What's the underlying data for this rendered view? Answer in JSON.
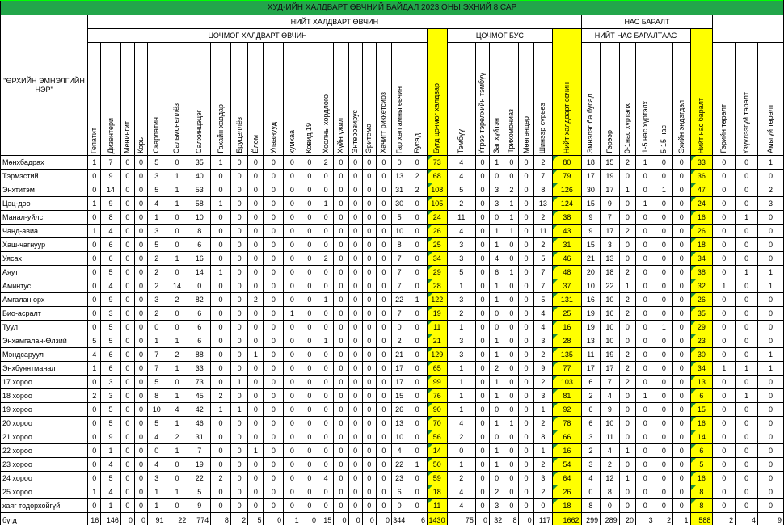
{
  "title": "ХУД-ИЙН ХАЛДВАРТ ӨВЧНИЙ БАЙДАЛ 2023 ОНЫ ЭХНИЙ 8 САР",
  "headers": {
    "total_infectious": "НИЙТ ХАЛДВАРТ ӨВЧИН",
    "population_loss": "НАС БАРАЛТ",
    "acute_infectious": "ЦОЧМОГ ХАЛДВАРТ ӨВЧИН",
    "non_acute": "ЦОЧМОГ БУС",
    "of_total_deaths": "НИЙТ НАС БАРАЛТААС",
    "facility_name": "\"ӨРХИЙН ЭМНЭЛГИЙН НЭР\""
  },
  "columns": [
    "Гепатит",
    "Дизентери",
    "Менингит",
    "Корь",
    "Скарлатин",
    "Сальмонеллёз",
    "Салхинцэцэг",
    "Гахайн хавдар",
    "Бруцеллёз",
    "Ёлом",
    "Улаанууд",
    "хумхаа",
    "Ковид 19",
    "Хоолны хордлого",
    "Хүйн үжил",
    "Энтеровирус",
    "Эритема",
    "Хачигт риккетсиоз",
    "Гар хөл амны өвчин",
    "Бусад",
    "Бүгд цочмог халдвар",
    "Тэмбүү",
    "Үтрээ тэрелхийн тэмбүү",
    "Заг хүйтэн",
    "Трихомониаз",
    "Мөөгөнцөр",
    "Шинээр сүрьеэ",
    "Нийт халдварт өвчин",
    "Эмнэлэг ба бусад",
    "Гэрээр",
    "0-1нас хүртэлх",
    "1-5 нас хүртэлх",
    "5-15 нас",
    "Эхийн эндэгдэл",
    "Нийт нас баралт",
    "Гэрийн төрөлт",
    "Үзүүлээгүй төрөлт",
    "Амьгүй төрөлт"
  ],
  "rows": [
    {
      "name": "Мөнхбадрах",
      "values": [
        "1",
        "7",
        "0",
        "0",
        "5",
        "0",
        "35",
        "1",
        "0",
        "0",
        "0",
        "0",
        "0",
        "2",
        "0",
        "0",
        "0",
        "0",
        "0",
        "0",
        "73",
        "4",
        "0",
        "1",
        "0",
        "0",
        "2",
        "80",
        "18",
        "15",
        "2",
        "1",
        "0",
        "0",
        "33",
        "0",
        "0",
        "1"
      ]
    },
    {
      "name": "Тэрмэстий",
      "values": [
        "0",
        "9",
        "0",
        "0",
        "3",
        "1",
        "40",
        "0",
        "0",
        "0",
        "0",
        "0",
        "0",
        "0",
        "0",
        "0",
        "0",
        "0",
        "13",
        "2",
        "68",
        "4",
        "0",
        "0",
        "0",
        "0",
        "7",
        "79",
        "17",
        "19",
        "0",
        "0",
        "0",
        "0",
        "36",
        "0",
        "0",
        "0"
      ]
    },
    {
      "name": "Энхтитэм",
      "values": [
        "0",
        "14",
        "0",
        "0",
        "5",
        "1",
        "53",
        "0",
        "0",
        "0",
        "0",
        "0",
        "0",
        "0",
        "0",
        "0",
        "0",
        "0",
        "31",
        "2",
        "108",
        "5",
        "0",
        "3",
        "2",
        "0",
        "8",
        "126",
        "30",
        "17",
        "1",
        "0",
        "1",
        "0",
        "47",
        "0",
        "0",
        "2"
      ]
    },
    {
      "name": "Цэц-доо",
      "values": [
        "1",
        "9",
        "0",
        "0",
        "4",
        "1",
        "58",
        "1",
        "0",
        "0",
        "0",
        "0",
        "0",
        "1",
        "0",
        "0",
        "0",
        "0",
        "30",
        "0",
        "105",
        "2",
        "0",
        "3",
        "1",
        "0",
        "13",
        "124",
        "15",
        "9",
        "0",
        "1",
        "0",
        "0",
        "24",
        "0",
        "0",
        "3"
      ]
    },
    {
      "name": "Манал-уйлс",
      "values": [
        "0",
        "8",
        "0",
        "0",
        "1",
        "0",
        "10",
        "0",
        "0",
        "0",
        "0",
        "0",
        "0",
        "0",
        "0",
        "0",
        "0",
        "0",
        "5",
        "0",
        "24",
        "11",
        "0",
        "0",
        "1",
        "0",
        "2",
        "38",
        "9",
        "7",
        "0",
        "0",
        "0",
        "0",
        "16",
        "0",
        "1",
        "0"
      ]
    },
    {
      "name": "Чанд-авиа",
      "values": [
        "1",
        "4",
        "0",
        "0",
        "3",
        "0",
        "8",
        "0",
        "0",
        "0",
        "0",
        "0",
        "0",
        "0",
        "0",
        "0",
        "0",
        "0",
        "10",
        "0",
        "26",
        "4",
        "0",
        "1",
        "1",
        "0",
        "11",
        "43",
        "9",
        "17",
        "2",
        "0",
        "0",
        "0",
        "26",
        "0",
        "0",
        "0"
      ]
    },
    {
      "name": "Хаш-чагнуур",
      "values": [
        "0",
        "6",
        "0",
        "0",
        "5",
        "0",
        "6",
        "0",
        "0",
        "0",
        "0",
        "0",
        "0",
        "0",
        "0",
        "0",
        "0",
        "0",
        "8",
        "0",
        "25",
        "3",
        "0",
        "1",
        "0",
        "0",
        "2",
        "31",
        "15",
        "3",
        "0",
        "0",
        "0",
        "0",
        "18",
        "0",
        "0",
        "0"
      ]
    },
    {
      "name": "Уясах",
      "values": [
        "0",
        "6",
        "0",
        "0",
        "2",
        "1",
        "16",
        "0",
        "0",
        "0",
        "0",
        "0",
        "0",
        "2",
        "0",
        "0",
        "0",
        "0",
        "7",
        "0",
        "34",
        "3",
        "0",
        "4",
        "0",
        "0",
        "5",
        "46",
        "21",
        "13",
        "0",
        "0",
        "0",
        "0",
        "34",
        "0",
        "0",
        "0"
      ]
    },
    {
      "name": "Аяут",
      "values": [
        "0",
        "5",
        "0",
        "0",
        "2",
        "0",
        "14",
        "1",
        "0",
        "0",
        "0",
        "0",
        "0",
        "0",
        "0",
        "0",
        "0",
        "0",
        "7",
        "0",
        "29",
        "5",
        "0",
        "6",
        "1",
        "0",
        "7",
        "48",
        "20",
        "18",
        "2",
        "0",
        "0",
        "0",
        "38",
        "0",
        "1",
        "1"
      ]
    },
    {
      "name": "Аминтус",
      "values": [
        "0",
        "4",
        "0",
        "0",
        "2",
        "14",
        "0",
        "0",
        "0",
        "0",
        "0",
        "0",
        "0",
        "0",
        "0",
        "0",
        "0",
        "0",
        "7",
        "0",
        "28",
        "1",
        "0",
        "1",
        "0",
        "0",
        "7",
        "37",
        "10",
        "22",
        "1",
        "0",
        "0",
        "0",
        "32",
        "1",
        "0",
        "1"
      ]
    },
    {
      "name": "Амгалан өрх",
      "values": [
        "0",
        "9",
        "0",
        "0",
        "3",
        "2",
        "82",
        "0",
        "0",
        "2",
        "0",
        "0",
        "0",
        "1",
        "0",
        "0",
        "0",
        "0",
        "22",
        "1",
        "122",
        "3",
        "0",
        "1",
        "0",
        "0",
        "5",
        "131",
        "16",
        "10",
        "2",
        "0",
        "0",
        "0",
        "26",
        "0",
        "0",
        "0"
      ]
    },
    {
      "name": "Био-асралт",
      "values": [
        "0",
        "3",
        "0",
        "0",
        "2",
        "0",
        "6",
        "0",
        "0",
        "0",
        "0",
        "1",
        "0",
        "0",
        "0",
        "0",
        "0",
        "0",
        "7",
        "0",
        "19",
        "2",
        "0",
        "0",
        "0",
        "0",
        "4",
        "25",
        "19",
        "16",
        "2",
        "0",
        "0",
        "0",
        "35",
        "0",
        "0",
        "0"
      ]
    },
    {
      "name": "Туул",
      "values": [
        "0",
        "5",
        "0",
        "0",
        "0",
        "0",
        "6",
        "0",
        "0",
        "0",
        "0",
        "0",
        "0",
        "0",
        "0",
        "0",
        "0",
        "0",
        "0",
        "0",
        "11",
        "1",
        "0",
        "0",
        "0",
        "0",
        "4",
        "16",
        "19",
        "10",
        "0",
        "0",
        "1",
        "0",
        "29",
        "0",
        "0",
        "0"
      ]
    },
    {
      "name": "Энхамгалан-Өлзий",
      "values": [
        "5",
        "5",
        "0",
        "0",
        "1",
        "1",
        "6",
        "0",
        "0",
        "0",
        "0",
        "0",
        "0",
        "1",
        "0",
        "0",
        "0",
        "0",
        "2",
        "0",
        "21",
        "3",
        "0",
        "1",
        "0",
        "0",
        "3",
        "28",
        "13",
        "10",
        "0",
        "0",
        "0",
        "0",
        "23",
        "0",
        "0",
        "0"
      ]
    },
    {
      "name": "Мэндсаруул",
      "values": [
        "4",
        "6",
        "0",
        "0",
        "7",
        "2",
        "88",
        "0",
        "0",
        "1",
        "0",
        "0",
        "0",
        "0",
        "0",
        "0",
        "0",
        "0",
        "21",
        "0",
        "129",
        "3",
        "0",
        "1",
        "0",
        "0",
        "2",
        "135",
        "11",
        "19",
        "2",
        "0",
        "0",
        "0",
        "30",
        "0",
        "0",
        "1"
      ]
    },
    {
      "name": "Энхбуянтманал",
      "values": [
        "1",
        "6",
        "0",
        "0",
        "7",
        "1",
        "33",
        "0",
        "0",
        "0",
        "0",
        "0",
        "0",
        "0",
        "0",
        "0",
        "0",
        "0",
        "17",
        "0",
        "65",
        "1",
        "0",
        "2",
        "0",
        "0",
        "9",
        "77",
        "17",
        "17",
        "2",
        "0",
        "0",
        "0",
        "34",
        "1",
        "1",
        "1"
      ]
    },
    {
      "name": "17 хороо",
      "values": [
        "0",
        "3",
        "0",
        "0",
        "5",
        "0",
        "73",
        "0",
        "1",
        "0",
        "0",
        "0",
        "0",
        "0",
        "0",
        "0",
        "0",
        "0",
        "17",
        "0",
        "99",
        "1",
        "0",
        "1",
        "0",
        "0",
        "2",
        "103",
        "6",
        "7",
        "2",
        "0",
        "0",
        "0",
        "13",
        "0",
        "0",
        "0"
      ]
    },
    {
      "name": "18 хороо",
      "values": [
        "2",
        "3",
        "0",
        "0",
        "8",
        "1",
        "45",
        "2",
        "0",
        "0",
        "0",
        "0",
        "0",
        "0",
        "0",
        "0",
        "0",
        "0",
        "15",
        "0",
        "76",
        "1",
        "0",
        "1",
        "0",
        "0",
        "3",
        "81",
        "2",
        "4",
        "0",
        "1",
        "0",
        "0",
        "6",
        "0",
        "1",
        "0"
      ]
    },
    {
      "name": "19 хороо",
      "values": [
        "0",
        "5",
        "0",
        "0",
        "10",
        "4",
        "42",
        "1",
        "1",
        "0",
        "0",
        "0",
        "0",
        "0",
        "0",
        "0",
        "0",
        "0",
        "26",
        "0",
        "90",
        "1",
        "0",
        "0",
        "0",
        "0",
        "1",
        "92",
        "6",
        "9",
        "0",
        "0",
        "0",
        "0",
        "15",
        "0",
        "0",
        "0"
      ]
    },
    {
      "name": "20 хороо",
      "values": [
        "0",
        "5",
        "0",
        "0",
        "5",
        "1",
        "46",
        "0",
        "0",
        "0",
        "0",
        "0",
        "0",
        "0",
        "0",
        "0",
        "0",
        "0",
        "13",
        "0",
        "70",
        "4",
        "0",
        "1",
        "1",
        "0",
        "2",
        "78",
        "6",
        "10",
        "0",
        "0",
        "0",
        "0",
        "16",
        "0",
        "0",
        "0"
      ]
    },
    {
      "name": "21 хороо",
      "values": [
        "0",
        "9",
        "0",
        "0",
        "4",
        "2",
        "31",
        "0",
        "0",
        "0",
        "0",
        "0",
        "0",
        "0",
        "0",
        "0",
        "0",
        "0",
        "10",
        "0",
        "56",
        "2",
        "0",
        "0",
        "0",
        "0",
        "8",
        "66",
        "3",
        "11",
        "0",
        "0",
        "0",
        "0",
        "14",
        "0",
        "0",
        "0"
      ]
    },
    {
      "name": "22 хороо",
      "values": [
        "0",
        "1",
        "0",
        "0",
        "0",
        "1",
        "7",
        "0",
        "0",
        "1",
        "0",
        "0",
        "0",
        "0",
        "0",
        "0",
        "0",
        "0",
        "4",
        "0",
        "14",
        "0",
        "0",
        "1",
        "0",
        "0",
        "1",
        "16",
        "2",
        "4",
        "1",
        "0",
        "0",
        "0",
        "6",
        "0",
        "0",
        "0"
      ]
    },
    {
      "name": "23 хороо",
      "values": [
        "0",
        "4",
        "0",
        "0",
        "4",
        "0",
        "19",
        "0",
        "0",
        "0",
        "0",
        "0",
        "0",
        "0",
        "0",
        "0",
        "0",
        "0",
        "22",
        "1",
        "50",
        "1",
        "0",
        "1",
        "0",
        "0",
        "2",
        "54",
        "3",
        "2",
        "0",
        "0",
        "0",
        "0",
        "5",
        "0",
        "0",
        "0"
      ]
    },
    {
      "name": "24 хороо",
      "values": [
        "0",
        "5",
        "0",
        "0",
        "3",
        "0",
        "22",
        "2",
        "0",
        "0",
        "0",
        "0",
        "0",
        "4",
        "0",
        "0",
        "0",
        "0",
        "23",
        "0",
        "59",
        "2",
        "0",
        "0",
        "0",
        "0",
        "3",
        "64",
        "4",
        "12",
        "1",
        "0",
        "0",
        "0",
        "16",
        "0",
        "0",
        "0"
      ]
    },
    {
      "name": "25 хороо",
      "values": [
        "1",
        "4",
        "0",
        "0",
        "1",
        "1",
        "5",
        "0",
        "0",
        "0",
        "0",
        "0",
        "0",
        "0",
        "0",
        "0",
        "0",
        "0",
        "6",
        "0",
        "18",
        "4",
        "0",
        "2",
        "0",
        "0",
        "2",
        "26",
        "0",
        "8",
        "0",
        "0",
        "0",
        "0",
        "8",
        "0",
        "0",
        "0"
      ]
    },
    {
      "name": "хаяг тодорхойгүй",
      "values": [
        "0",
        "1",
        "0",
        "0",
        "1",
        "0",
        "9",
        "0",
        "0",
        "0",
        "0",
        "0",
        "0",
        "0",
        "0",
        "0",
        "0",
        "0",
        "0",
        "0",
        "11",
        "4",
        "0",
        "3",
        "0",
        "0",
        "0",
        "18",
        "8",
        "0",
        "0",
        "0",
        "0",
        "0",
        "8",
        "0",
        "0",
        "0"
      ]
    }
  ],
  "total": {
    "name": "бүгд",
    "values": [
      "16",
      "146",
      "0",
      "0",
      "91",
      "22",
      "774",
      "8",
      "2",
      "5",
      "0",
      "1",
      "0",
      "15",
      "0",
      "0",
      "0",
      "0",
      "344",
      "6",
      "1430",
      "75",
      "0",
      "32",
      "8",
      "0",
      "117",
      "1662",
      "299",
      "289",
      "20",
      "3",
      "2",
      "1",
      "588",
      "2",
      "4",
      "9"
    ]
  },
  "highlight_color": "#ffff00",
  "title_color": "#22a64a"
}
